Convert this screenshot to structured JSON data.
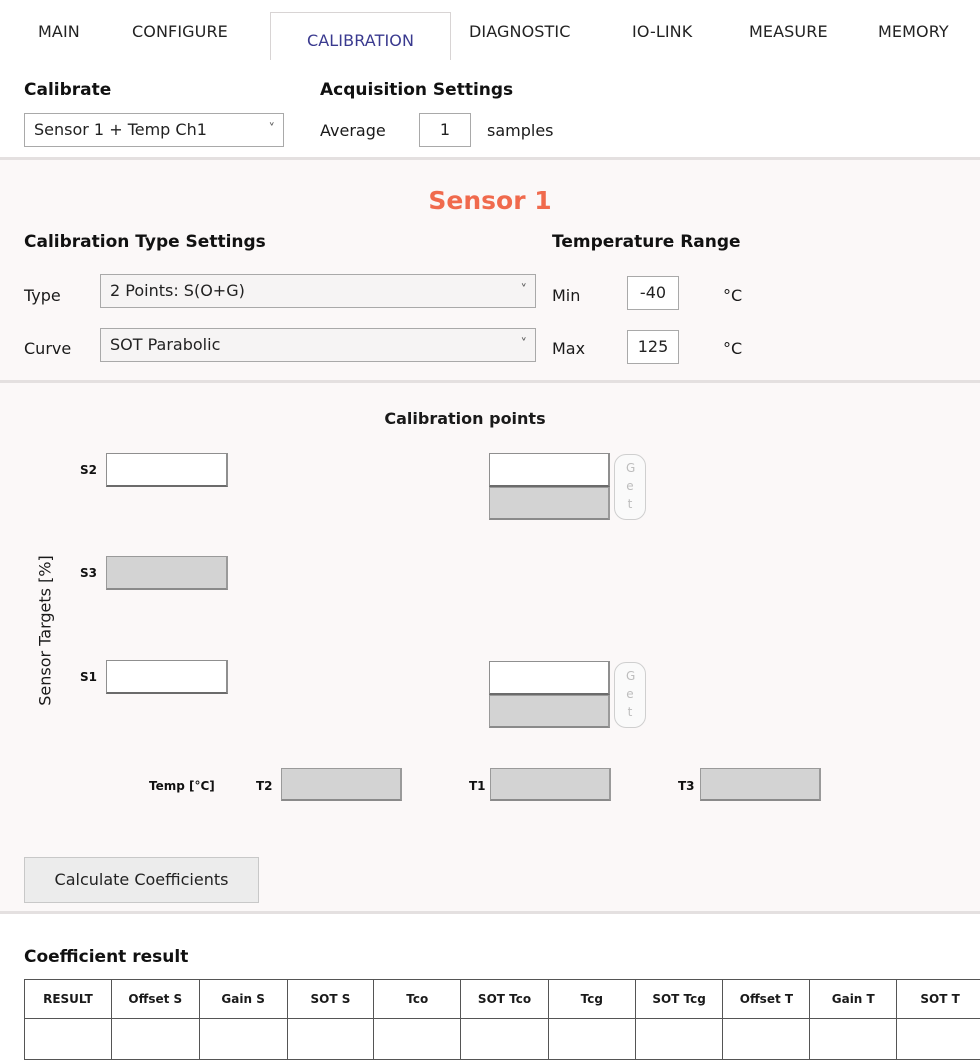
{
  "tabs": [
    {
      "label": "MAIN"
    },
    {
      "label": "CONFIGURE"
    },
    {
      "label": "CALIBRATION"
    },
    {
      "label": "DIAGNOSTIC"
    },
    {
      "label": "IO-LINK"
    },
    {
      "label": "MEASURE"
    },
    {
      "label": "MEMORY"
    }
  ],
  "calibrate": {
    "title": "Calibrate",
    "selected": "Sensor 1 + Temp Ch1"
  },
  "acquisition": {
    "title": "Acquisition Settings",
    "average_label": "Average",
    "average_value": "1",
    "samples_label": "samples"
  },
  "sensor_title": "Sensor 1",
  "calibration_type": {
    "title": "Calibration Type Settings",
    "type_label": "Type",
    "type_value": "2 Points: S(O+G)",
    "curve_label": "Curve",
    "curve_value": "SOT Parabolic"
  },
  "temperature_range": {
    "title": "Temperature Range",
    "min_label": "Min",
    "min_value": "-40",
    "min_unit": "°C",
    "max_label": "Max",
    "max_value": "125",
    "max_unit": "°C"
  },
  "calibration_points": {
    "title": "Calibration points",
    "axis_label": "Sensor Targets [%]",
    "s2": "S2",
    "s3": "S3",
    "s1": "S1",
    "get_label": "Get",
    "temp_label": "Temp [°C]",
    "t2": "T2",
    "t1": "T1",
    "t3": "T3"
  },
  "calculate_button": "Calculate Coefficients",
  "coefficient_result": {
    "title": "Coefficient result",
    "columns": [
      "RESULT",
      "Offset S",
      "Gain S",
      "SOT S",
      "Tco",
      "SOT Tco",
      "Tcg",
      "SOT Tcg",
      "Offset T",
      "Gain T",
      "SOT T"
    ]
  },
  "colors": {
    "sensor_title": "#f06a4d",
    "active_tab": "#3a3a8f",
    "panel_bg": "#fbf8f8"
  }
}
